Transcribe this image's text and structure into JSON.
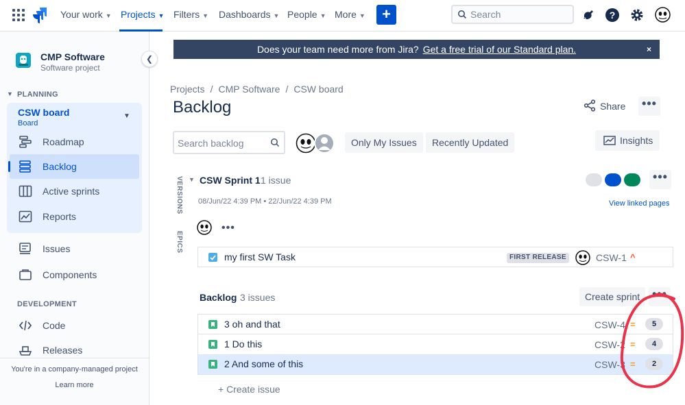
{
  "nav": {
    "items": [
      {
        "label": "Your work"
      },
      {
        "label": "Projects"
      },
      {
        "label": "Filters"
      },
      {
        "label": "Dashboards"
      },
      {
        "label": "People"
      },
      {
        "label": "More"
      }
    ],
    "active": "Projects",
    "create_label": "+",
    "search_placeholder": "Search"
  },
  "sidebar": {
    "project_name": "CMP Software",
    "project_type": "Software project",
    "planning_header": "PLANNING",
    "board_name": "CSW board",
    "board_type": "Board",
    "planning_items": [
      {
        "label": "Roadmap",
        "icon": "roadmap-icon"
      },
      {
        "label": "Backlog",
        "icon": "backlog-icon",
        "active": true
      },
      {
        "label": "Active sprints",
        "icon": "board-icon"
      },
      {
        "label": "Reports",
        "icon": "reports-icon"
      }
    ],
    "other_items": [
      {
        "label": "Issues",
        "icon": "issues-icon"
      },
      {
        "label": "Components",
        "icon": "components-icon"
      }
    ],
    "development_header": "DEVELOPMENT",
    "dev_items": [
      {
        "label": "Code",
        "icon": "code-icon"
      },
      {
        "label": "Releases",
        "icon": "releases-icon"
      }
    ],
    "footer_text": "You're in a company-managed project",
    "footer_link": "Learn more"
  },
  "banner": {
    "message": "Does your team need more from Jira?",
    "link": "Get a free trial of our Standard plan.",
    "close": "×"
  },
  "breadcrumb": [
    "Projects",
    "CMP Software",
    "CSW board"
  ],
  "breadcrumb_sep": "/",
  "page_title": "Backlog",
  "share_label": "Share",
  "more_label": "•••",
  "backlog_search_placeholder": "Search backlog",
  "filters": [
    "Only My Issues",
    "Recently Updated"
  ],
  "insights_label": "Insights",
  "side_tabs": [
    "VERSIONS",
    "EPICS"
  ],
  "sprint": {
    "name": "CSW Sprint 1",
    "count": "1 issue",
    "dates": "08/Jun/22 4:39 PM  •  22/Jun/22 4:39 PM",
    "status_colors": [
      "#dfe1e6",
      "#0052cc",
      "#00875a"
    ],
    "view_linked": "View linked pages",
    "issues": [
      {
        "summary": "my first SW Task",
        "type": "task",
        "fix_version": "FIRST RELEASE",
        "key": "CSW-1",
        "priority": "^"
      }
    ]
  },
  "backlog": {
    "title": "Backlog",
    "count": "3 issues",
    "create_sprint": "Create sprint",
    "issues": [
      {
        "summary": "3 oh and that",
        "type": "story",
        "key": "CSW-4",
        "priority": "=",
        "points": "5"
      },
      {
        "summary": "1 Do this",
        "type": "story",
        "key": "CSW-2",
        "priority": "=",
        "points": "4"
      },
      {
        "summary": "2 And some of this",
        "type": "story",
        "key": "CSW-3",
        "priority": "=",
        "points": "2",
        "selected": true
      }
    ],
    "create_issue": "+   Create issue"
  },
  "colors": {
    "brand": "#0052cc",
    "story": "#36b37e",
    "task": "#4bade8",
    "annotation": "#e8334a"
  }
}
